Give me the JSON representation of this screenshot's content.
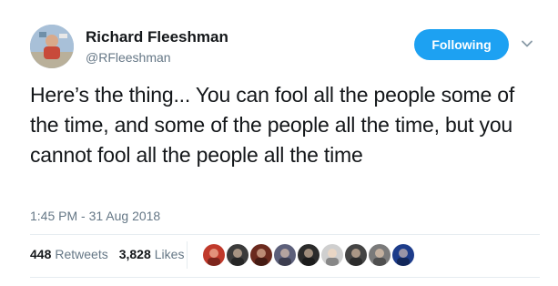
{
  "author": {
    "name": "Richard Fleeshman",
    "handle": "@RFleeshman"
  },
  "follow_button": {
    "label": "Following",
    "color": "#1da1f2"
  },
  "caret_icon": "chevron-down-icon",
  "tweet": {
    "text": "Here’s the thing... You can fool all the people some of the time, and some of the people all the time, but you cannot fool all the people all the time",
    "timestamp": "1:45 PM - 31 Aug 2018"
  },
  "stats": {
    "retweets_count": "448",
    "retweets_label": "Retweets",
    "likes_count": "3,828",
    "likes_label": "Likes"
  },
  "liked_by_avatars": [
    {
      "color": "#c0392b"
    },
    {
      "color": "#3b3b3b"
    },
    {
      "color": "#6b2a1e"
    },
    {
      "color": "#5c5f7a"
    },
    {
      "color": "#2b2b2b"
    },
    {
      "color": "#cfcfcf"
    },
    {
      "color": "#444444"
    },
    {
      "color": "#7a7a7a"
    },
    {
      "color": "#1d3c8a"
    }
  ],
  "colors": {
    "text_primary": "#14171a",
    "text_secondary": "#657786",
    "accent": "#1da1f2",
    "divider": "#e6ecf0"
  }
}
